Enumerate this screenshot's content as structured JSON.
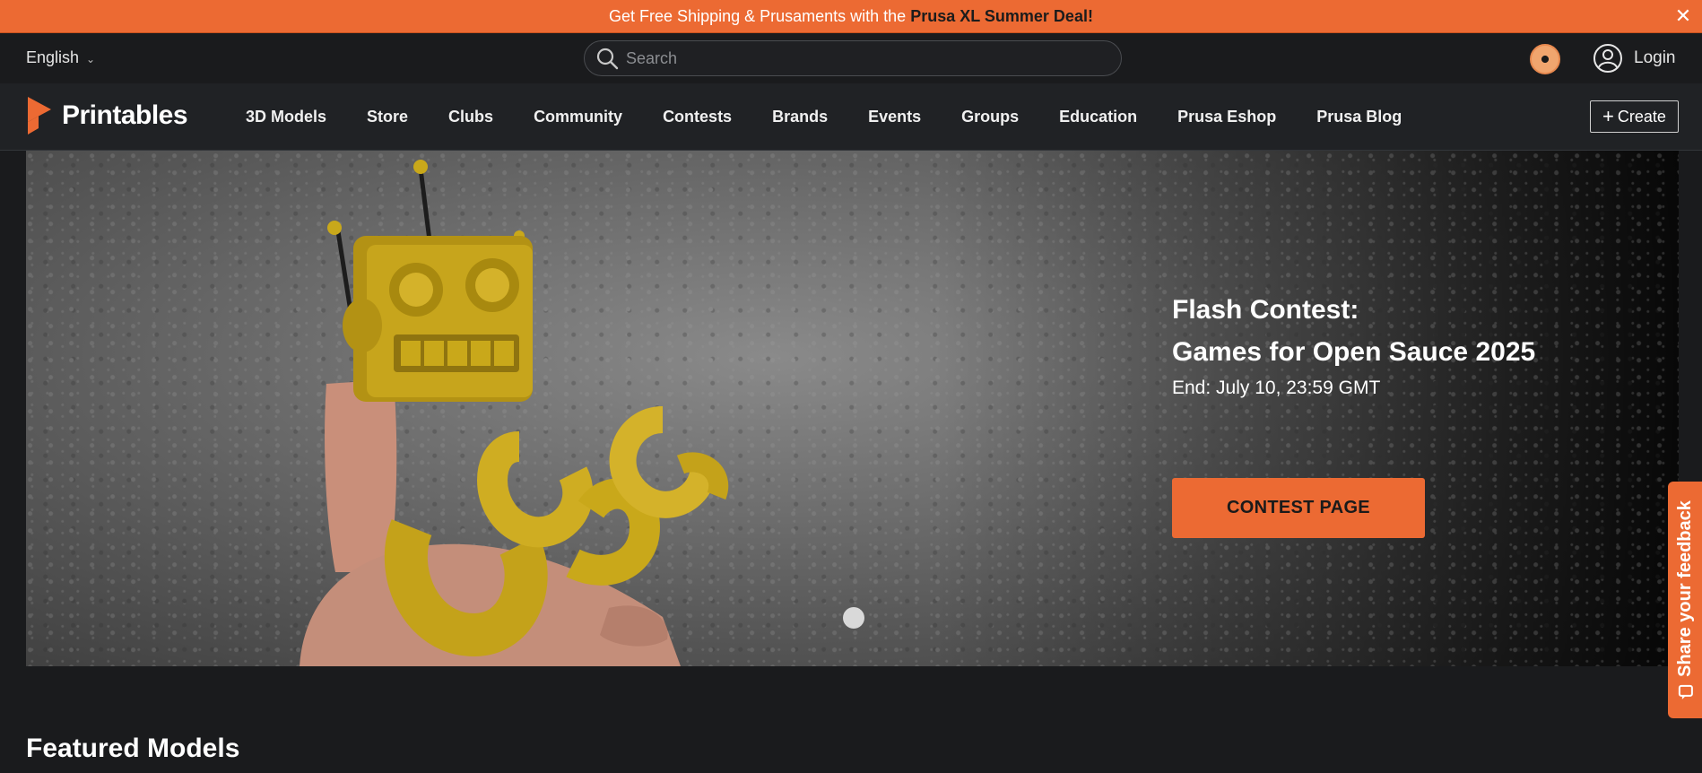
{
  "promo": {
    "text": "Get Free Shipping & Prusaments with the",
    "highlight": "Prusa XL Summer Deal!",
    "close_icon": "close-icon"
  },
  "topbar": {
    "language": "English",
    "search_placeholder": "Search",
    "login_label": "Login"
  },
  "navbar": {
    "brand": "Printables",
    "items": [
      "3D Models",
      "Store",
      "Clubs",
      "Community",
      "Contests",
      "Brands",
      "Events",
      "Groups",
      "Education",
      "Prusa Eshop",
      "Prusa Blog"
    ],
    "create_label": "Create"
  },
  "hero": {
    "kicker": "Flash Contest:",
    "title": "Games for Open Sauce 2025",
    "end_date": "End: July 10, 23:59 GMT",
    "cta_label": "CONTEST PAGE"
  },
  "feedback": {
    "label": "Share your feedback"
  },
  "featured": {
    "title": "Featured Models"
  },
  "colors": {
    "accent": "#ec6a33",
    "background": "#1a1b1d",
    "navbar": "#202225"
  }
}
